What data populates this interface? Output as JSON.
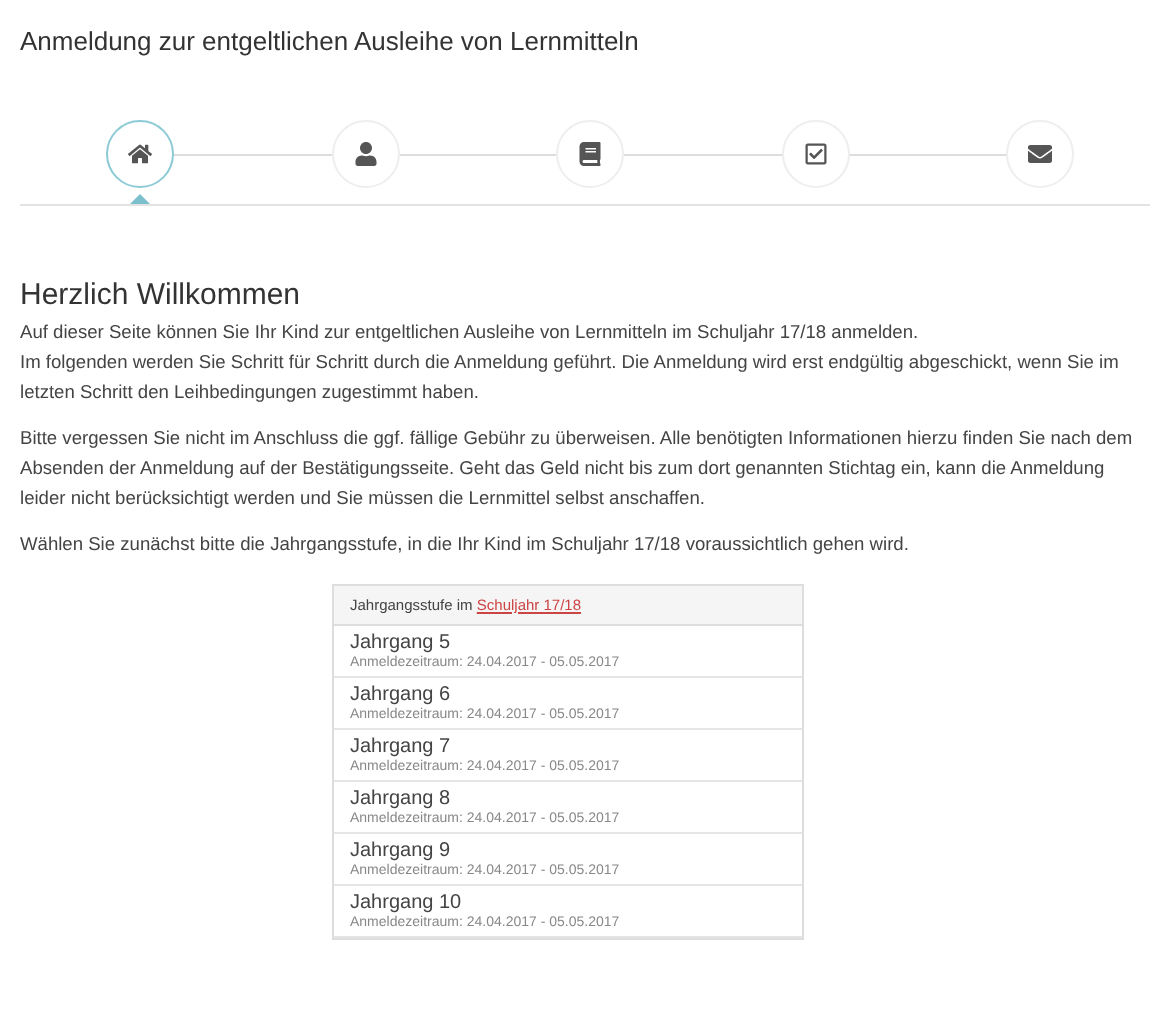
{
  "page_title": "Anmeldung zur entgeltlichen Ausleihe von Lernmitteln",
  "steps": [
    {
      "kind": "home",
      "selected": true
    },
    {
      "kind": "person",
      "selected": false
    },
    {
      "kind": "book",
      "selected": false
    },
    {
      "kind": "check",
      "selected": false
    },
    {
      "kind": "mail",
      "selected": false
    }
  ],
  "heading": "Herzlich Willkommen",
  "paragraphs": [
    [
      "Auf dieser Seite können Sie Ihr Kind zur entgeltlichen Ausleihe von Lernmitteln im Schuljahr 17/18 anmelden.",
      "Im folgenden werden Sie Schritt für Schritt durch die Anmeldung geführt. Die Anmeldung wird erst endgültig abgeschickt, wenn Sie im letzten Schritt den Leihbedingungen zugestimmt haben."
    ],
    [
      "Bitte vergessen Sie nicht im Anschluss die ggf. fällige Gebühr zu überweisen. Alle benötigten Informationen hierzu finden Sie nach dem Absenden der Anmeldung auf der Bestätigungsseite. Geht das Geld nicht bis zum dort genannten Stichtag ein, kann die Anmeldung leider nicht berücksichtigt werden und Sie müssen die Lernmittel selbst anschaffen."
    ],
    [
      "Wählen Sie zunächst bitte die Jahrgangsstufe, in die Ihr Kind im Schuljahr 17/18 voraussichtlich gehen wird."
    ]
  ],
  "list": {
    "header": "Jahrgangsstufe im",
    "header_link": "Schuljahr 17/18",
    "items": [
      {
        "title": "Jahrgang 5",
        "subtitle": "Anmeldezeitraum: 24.04.2017 - 05.05.2017"
      },
      {
        "title": "Jahrgang 6",
        "subtitle": "Anmeldezeitraum: 24.04.2017 - 05.05.2017"
      },
      {
        "title": "Jahrgang 7",
        "subtitle": "Anmeldezeitraum: 24.04.2017 - 05.05.2017"
      },
      {
        "title": "Jahrgang 8",
        "subtitle": "Anmeldezeitraum: 24.04.2017 - 05.05.2017"
      },
      {
        "title": "Jahrgang 9",
        "subtitle": "Anmeldezeitraum: 24.04.2017 - 05.05.2017"
      },
      {
        "title": "Jahrgang 10",
        "subtitle": "Anmeldezeitraum: 24.04.2017 - 05.05.2017"
      }
    ]
  }
}
